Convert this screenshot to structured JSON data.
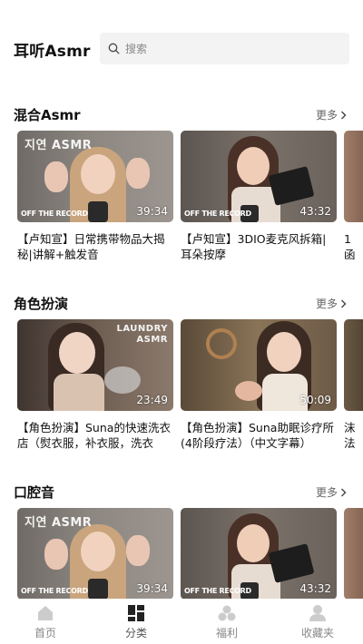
{
  "header": {
    "app_title": "耳听Asmr",
    "search_placeholder": "搜索"
  },
  "sections": [
    {
      "title": "混合Asmr",
      "more_label": "更多",
      "cards": [
        {
          "title": "【卢知宣】日常携带物品大揭秘|讲解+触发音",
          "duration": "39:34",
          "watermark": "OFF THE RECORD",
          "overlay_text": "지연 ASMR"
        },
        {
          "title": "【卢知宣】3DIO麦克风拆箱|耳朵按摩",
          "duration": "43:32",
          "watermark": "OFF THE RECORD"
        },
        {
          "title": "1\n函"
        }
      ]
    },
    {
      "title": "角色扮演",
      "more_label": "更多",
      "cards": [
        {
          "title": "【角色扮演】Suna的快速洗衣店（熨衣服，补衣服，洗衣",
          "duration": "23:49",
          "overlay_text": "LAUNDRY\nASMR"
        },
        {
          "title": "【角色扮演】Suna助眠诊疗所(4阶段疗法）（中文字幕）",
          "duration": "50:09"
        },
        {
          "title": "沫\n法"
        }
      ]
    },
    {
      "title": "口腔音",
      "more_label": "更多",
      "cards": [
        {
          "title": "",
          "duration": "39:34",
          "watermark": "OFF THE RECORD",
          "overlay_text": "지연 ASMR"
        },
        {
          "title": "",
          "duration": "43:32",
          "watermark": "OFF THE RECORD"
        },
        {
          "title": ""
        }
      ]
    }
  ],
  "tabbar": {
    "items": [
      {
        "label": "首页",
        "icon": "home-icon"
      },
      {
        "label": "分类",
        "icon": "category-icon"
      },
      {
        "label": "福利",
        "icon": "gift-icon"
      },
      {
        "label": "收藏夹",
        "icon": "favorites-icon"
      }
    ],
    "active_index": 1
  },
  "colors": {
    "title_text": "#111111",
    "secondary_text": "#666666",
    "search_bg": "#f3f3f3",
    "tab_inactive": "#cccccc",
    "tab_active": "#222222"
  }
}
